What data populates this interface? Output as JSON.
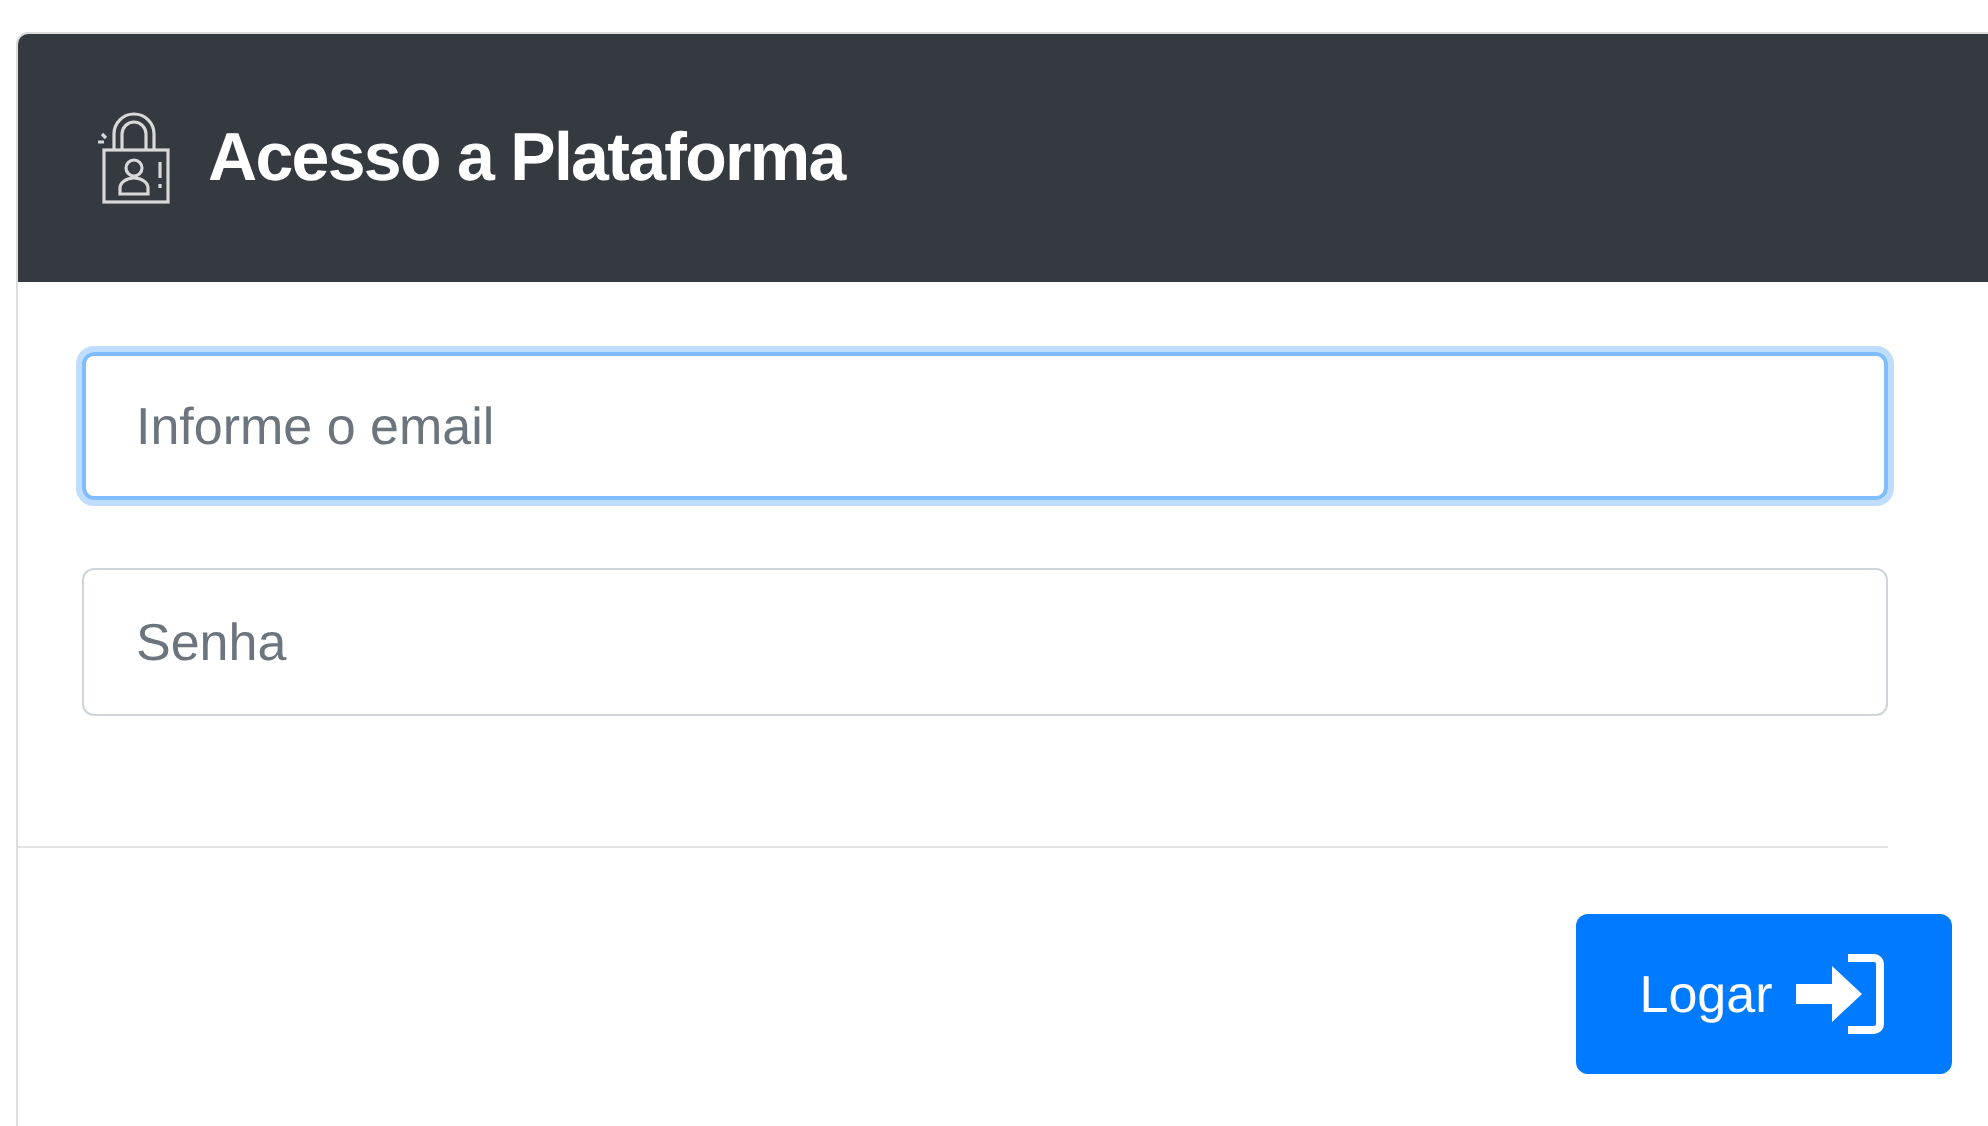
{
  "header": {
    "title": "Acesso a Plataforma"
  },
  "fields": [
    {
      "placeholder": "Informe o email",
      "focused": true
    },
    {
      "placeholder": "Senha",
      "focused": false
    }
  ],
  "footer": {
    "button": "Logar"
  }
}
